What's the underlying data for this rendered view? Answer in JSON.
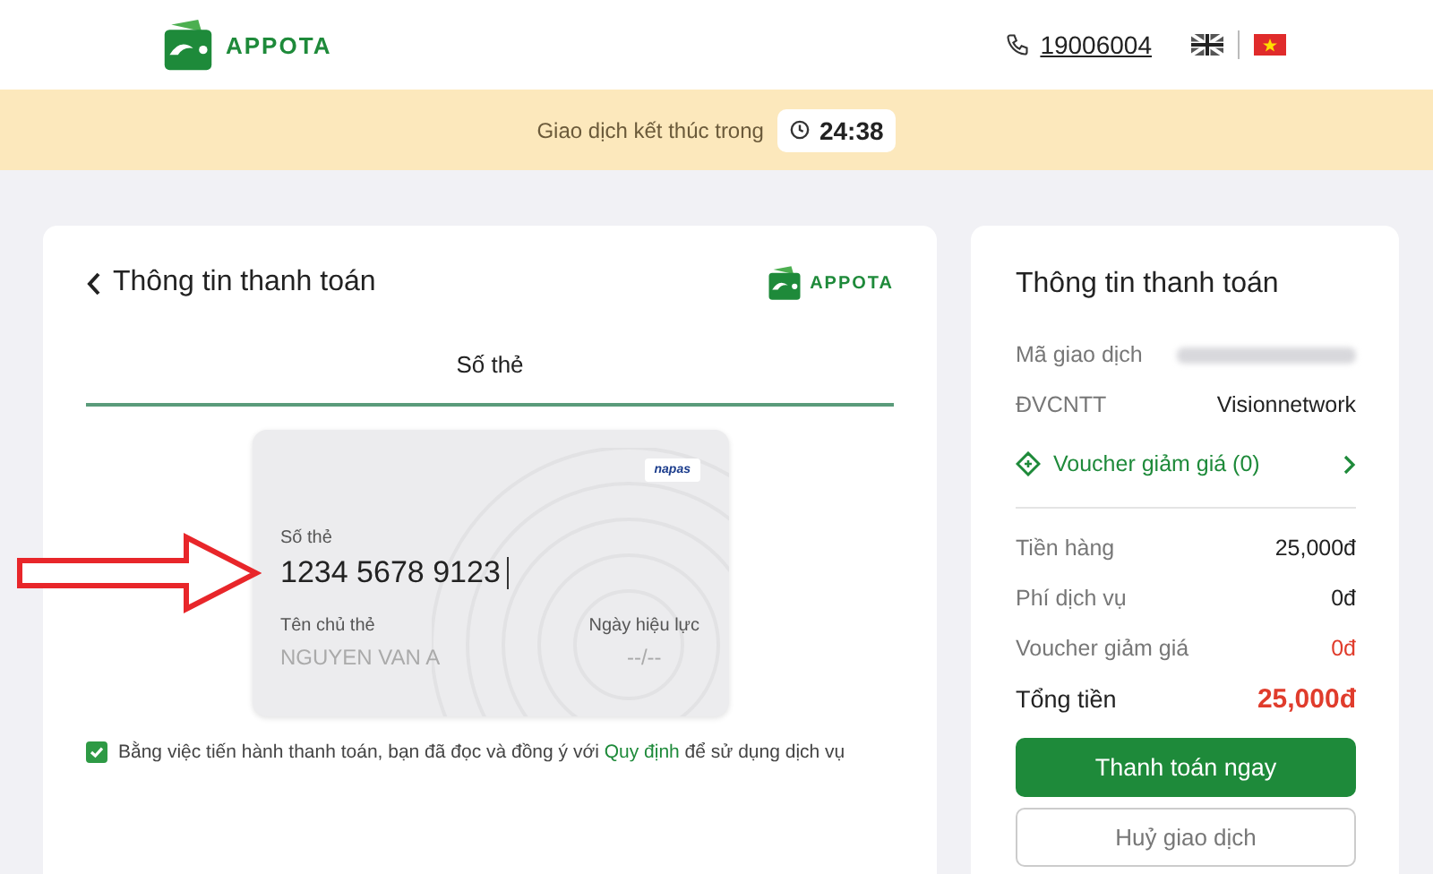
{
  "header": {
    "logo_text": "APPOTA",
    "phone": "19006004"
  },
  "banner": {
    "label": "Giao dịch kết thúc trong",
    "timer": "24:38"
  },
  "payment": {
    "title": "Thông tin thanh toán",
    "logo_text": "APPOTA",
    "tabs": [
      {
        "label": "Số thẻ",
        "selected": true
      }
    ],
    "card": {
      "number_label": "Số thẻ",
      "number": "1234 5678 9123",
      "brand": "napas",
      "holder_label": "Tên chủ thẻ",
      "holder_placeholder": "NGUYEN VAN A",
      "expiry_label": "Ngày hiệu lực",
      "expiry_placeholder": "--/--"
    },
    "consent": {
      "checked": true,
      "text": "Bằng việc tiến hành thanh toán, bạn đã đọc và đồng ý với",
      "link": "Quy định",
      "text_after": "để sử dụng dịch vụ"
    }
  },
  "summary": {
    "title": "Thông tin thanh toán",
    "details": [
      {
        "kind": "blurred",
        "label": "Mã giao dịch"
      },
      {
        "kind": "text",
        "label": "ĐVCNTT",
        "value": "Visionnetwork"
      }
    ],
    "voucher": "Voucher giảm giá (0)",
    "amounts": [
      {
        "kind": "normal",
        "label": "Tiền hàng",
        "value": "25,000đ"
      },
      {
        "kind": "normal",
        "label": "Phí dịch vụ",
        "value": "0đ"
      },
      {
        "kind": "discount",
        "label": "Voucher giảm giá",
        "value": "0đ"
      },
      {
        "kind": "total",
        "label": "Tổng tiền",
        "value": "25,000đ"
      }
    ],
    "pay_button": "Thanh toán ngay",
    "cancel_button": "Huỷ giao dịch"
  }
}
